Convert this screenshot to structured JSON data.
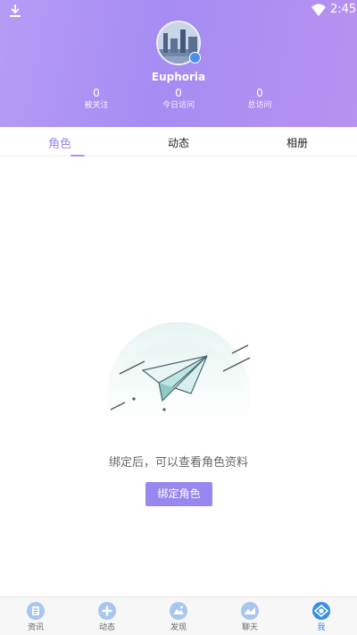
{
  "status_bar": {
    "time": "2:45"
  },
  "profile": {
    "username": "Euphoria",
    "stats": [
      {
        "value": "0",
        "label": "被关注"
      },
      {
        "value": "0",
        "label": "今日访问"
      },
      {
        "value": "0",
        "label": "总访问"
      }
    ]
  },
  "tabs": [
    {
      "label": "角色",
      "active": true
    },
    {
      "label": "动态",
      "active": false
    },
    {
      "label": "相册",
      "active": false
    }
  ],
  "empty_state": {
    "message": "绑定后，可以查看角色资料",
    "button_label": "绑定角色"
  },
  "bottom_nav": [
    {
      "label": "资讯",
      "icon": "news-icon"
    },
    {
      "label": "动态",
      "icon": "plus-icon"
    },
    {
      "label": "发现",
      "icon": "discover-icon"
    },
    {
      "label": "聊天",
      "icon": "chat-icon"
    },
    {
      "label": "我",
      "icon": "me-icon",
      "active": true
    }
  ],
  "colors": {
    "header_gradient_start": "#b59cf5",
    "header_gradient_end": "#b792f0",
    "accent": "#9987f0",
    "nav_active": "#3a8ee6"
  }
}
